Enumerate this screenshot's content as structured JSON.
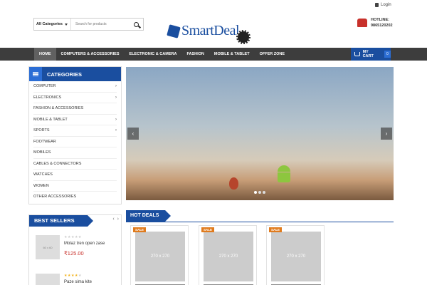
{
  "header": {
    "login_label": "Login",
    "search": {
      "category_label": "All Categories",
      "placeholder": "Search for products"
    },
    "logo_text": "SmartDeal",
    "hotline_label": "HOTLINE:",
    "hotline_number": "9865120202"
  },
  "nav": {
    "items": [
      "HOME",
      "COMPUTERS & ACCESSORIES",
      "ELECTRONIC & CAMERA",
      "FASHION",
      "MOBILE & TABLET",
      "OFFER ZONE"
    ],
    "cart_label": "MY CART",
    "cart_count": "0"
  },
  "categories": {
    "title": "CATEGORIES",
    "items": [
      {
        "label": "COMPUTER",
        "has_sub": true
      },
      {
        "label": "ELECTRONICS",
        "has_sub": true
      },
      {
        "label": "FASHION & ACCESSORIES",
        "has_sub": false
      },
      {
        "label": "MOBILE & TABLET",
        "has_sub": true
      },
      {
        "label": "SPORTS",
        "has_sub": true
      },
      {
        "label": "FOOTWEAR",
        "has_sub": false
      },
      {
        "label": "MOBILES",
        "has_sub": false
      },
      {
        "label": "CABLES & CONNECTORS",
        "has_sub": false
      },
      {
        "label": "WATCHES",
        "has_sub": false
      },
      {
        "label": "WOMEN",
        "has_sub": false
      },
      {
        "label": "OTHER ACCESSORIES",
        "has_sub": false
      }
    ]
  },
  "slider": {
    "dots": 3,
    "active_dot": 0
  },
  "best_sellers": {
    "title": "BEST SELLERS",
    "items": [
      {
        "thumb_label": "60 x 60",
        "name": "Molaz tren open zase",
        "price": "₹125.00",
        "rating": 0
      },
      {
        "thumb_label": "",
        "name": "Paze sima kite",
        "price": "",
        "rating": 4
      }
    ]
  },
  "hot_deals": {
    "title": "HOT DEALS",
    "items": [
      {
        "badge": "SALE",
        "image_label": "270 x 270"
      },
      {
        "badge": "SALE",
        "image_label": "270 x 270"
      },
      {
        "badge": "SALE",
        "image_label": "270 x 270"
      }
    ]
  },
  "colors": {
    "brand_blue": "#1a4e9f",
    "nav_dark": "#3d3d3d",
    "price_red": "#c8312b",
    "sale_orange": "#e07b1d"
  }
}
